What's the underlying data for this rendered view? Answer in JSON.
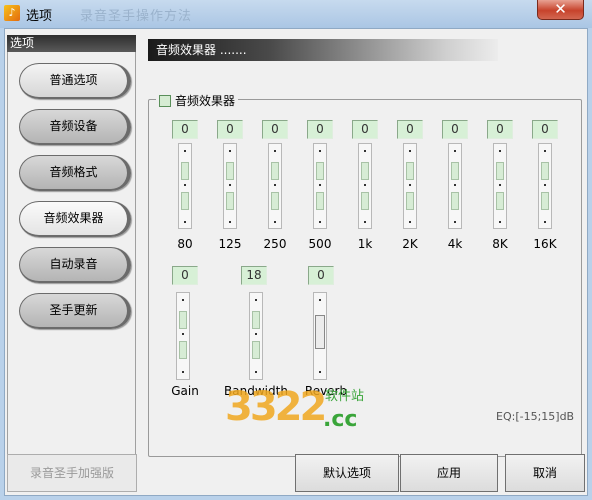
{
  "window": {
    "title": "选项",
    "faint_title": "录音圣手操作方法",
    "close_label": "✕",
    "app_icon_glyph": "♪"
  },
  "nav": {
    "header": "选项",
    "items": [
      {
        "label": "普通选项"
      },
      {
        "label": "音频设备"
      },
      {
        "label": "音频格式"
      },
      {
        "label": "音频效果器"
      },
      {
        "label": "自动录音"
      },
      {
        "label": "圣手更新"
      }
    ],
    "upgrade_label": "录音圣手加强版"
  },
  "header": {
    "text": "音频效果器 ......."
  },
  "effects": {
    "group_label": "音频效果器",
    "enabled": false,
    "bands": [
      {
        "value": "0",
        "freq": "80"
      },
      {
        "value": "0",
        "freq": "125"
      },
      {
        "value": "0",
        "freq": "250"
      },
      {
        "value": "0",
        "freq": "500"
      },
      {
        "value": "0",
        "freq": "1k"
      },
      {
        "value": "0",
        "freq": "2K"
      },
      {
        "value": "0",
        "freq": "4k"
      },
      {
        "value": "0",
        "freq": "8K"
      },
      {
        "value": "0",
        "freq": "16K"
      }
    ],
    "extra": [
      {
        "value": "0",
        "label": "Gain"
      },
      {
        "value": "18",
        "label": "Bandwidth"
      },
      {
        "value": "0",
        "label": "Reverb"
      }
    ],
    "range_text": "EQ:[-15;15]dB"
  },
  "watermark": {
    "number": "3322",
    "domain": ".cc",
    "site": "软件站"
  },
  "footer": {
    "default_label": "默认选项",
    "apply_label": "应用",
    "cancel_label": "取消"
  },
  "colors": {
    "value_box": "#d7f0d6",
    "accent_green": "#3aa53a",
    "watermark_orange": "#f0a820"
  }
}
